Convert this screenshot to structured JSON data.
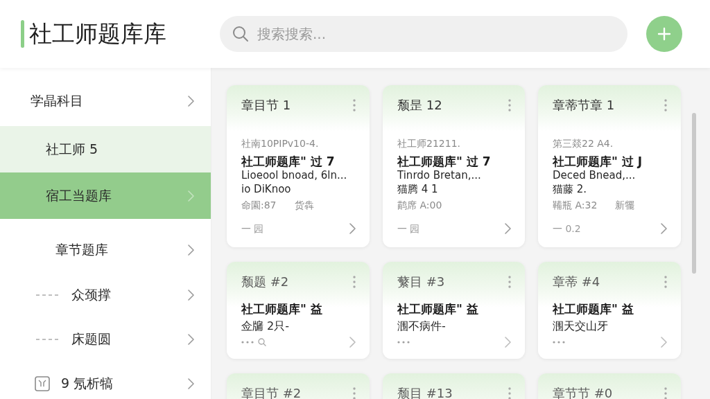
{
  "header": {
    "title": "社工师题库库",
    "search": {
      "placeholder": "搜索搜索..."
    }
  },
  "sidebar": {
    "items": [
      {
        "kind": "category",
        "label": "学晶科目",
        "selected": false,
        "expanded": false
      },
      {
        "kind": "subject",
        "label": "社工师 5",
        "selected": false,
        "expanded": true
      },
      {
        "kind": "subject",
        "label": "宿工当题库",
        "selected": true,
        "expanded": false
      },
      {
        "kind": "chapter",
        "label": "章节题库",
        "selected": false,
        "expanded": false
      },
      {
        "kind": "topic",
        "label": "众颈撑",
        "selected": false,
        "expanded": false
      },
      {
        "kind": "topic",
        "label": "床题圆",
        "selected": false,
        "expanded": false
      },
      {
        "kind": "tool",
        "label": "9 氖析犒",
        "selected": false,
        "expanded": false
      }
    ]
  },
  "cards": [
    {
      "kind": "detail",
      "title": "章目节 1",
      "code": "社南10PIPv10-4.",
      "heading": "社工师题库\" 过 7",
      "lines": [
        "Lioeool bnoad, 6ln...",
        "io DiKnoo"
      ],
      "meta": [
        "命園:87",
        "货犇"
      ],
      "footer": "一 园"
    },
    {
      "kind": "detail",
      "title": "颓昰 12",
      "code": "社工师21211.",
      "heading": "社工师题库\" 过 7",
      "lines": [
        "Tinrdo Bretan,...",
        "猫腾 4 1"
      ],
      "meta": [
        "鹋席 A:00"
      ],
      "footer": "一 园"
    },
    {
      "kind": "detail",
      "title": "章蒂节章 1",
      "code": "第三燚22 A4.",
      "heading": "社工师题库\" 过 J",
      "lines": [
        "Deced Bnead,...",
        "猫藤 2."
      ],
      "meta": [
        "鞴瓶 A:32",
        "新犤"
      ],
      "footer": "一 0.2"
    },
    {
      "kind": "brief",
      "title": "颓题 #2",
      "heading": "社工师题库\" 益",
      "lines": [
        "佥牖 2只-"
      ],
      "search_hint": true
    },
    {
      "kind": "brief",
      "title": "蘩目 #3",
      "heading": "社工师题库\" 益",
      "lines": [
        "涠不病件-"
      ],
      "search_hint": false
    },
    {
      "kind": "brief",
      "title": "章蒂 #4",
      "heading": "社工师题库\" 益",
      "lines": [
        "涠天交山牙"
      ],
      "search_hint": false
    },
    {
      "kind": "stub",
      "title": "章目节 #2"
    },
    {
      "kind": "stub",
      "title": "颓目 #13"
    },
    {
      "kind": "stub",
      "title": "章节节 #0"
    }
  ]
}
